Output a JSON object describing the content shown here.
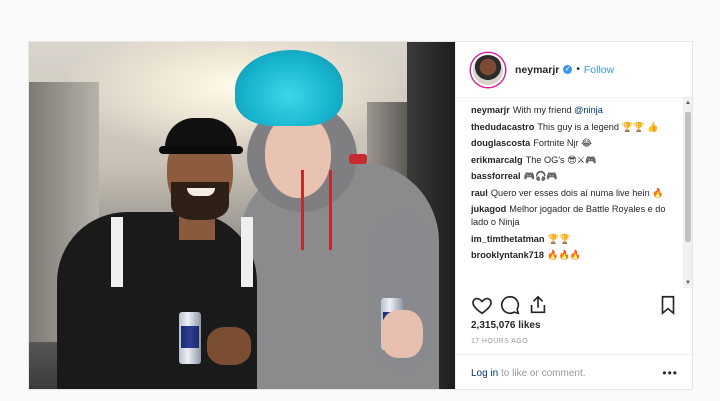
{
  "post": {
    "username": "neymarjr",
    "follow_label": "Follow",
    "separator": "•",
    "verified_glyph": "✓"
  },
  "comments": [
    {
      "user": "neymarjr",
      "text": "With my friend ",
      "mention": "@ninja"
    },
    {
      "user": "thedudacastro",
      "text": "This guy is a legend 🏆🏆 👍",
      "mention": ""
    },
    {
      "user": "douglascosta",
      "text": "Fortnite Njr 😂",
      "mention": ""
    },
    {
      "user": "erikmarcalg",
      "text": "The OG's 😎⚔🎮",
      "mention": ""
    },
    {
      "user": "bassforreal",
      "text": "🎮🎧🎮",
      "mention": ""
    },
    {
      "user": "raul",
      "text": "Quero ver esses dois aí numa live hein 🔥",
      "mention": ""
    },
    {
      "user": "jukagod",
      "text": "Melhor jogador de Battle Royales e do lado o Ninja",
      "mention": ""
    },
    {
      "user": "im_timthetatman",
      "text": "🏆🏆",
      "mention": ""
    },
    {
      "user": "brooklyntank718",
      "text": "🔥🔥🔥",
      "mention": ""
    }
  ],
  "likes": "2,315,076 likes",
  "time_ago": "17 HOURS AGO",
  "footer": {
    "login_link": "Log in",
    "login_rest": " to like or comment.",
    "more": "•••"
  },
  "icons": [
    "heart-icon",
    "comment-icon",
    "share-icon",
    "bookmark-icon",
    "more-options-icon"
  ],
  "colors": {
    "link_blue": "#3897f0",
    "mention_blue": "#003569",
    "border": "#efefef"
  }
}
